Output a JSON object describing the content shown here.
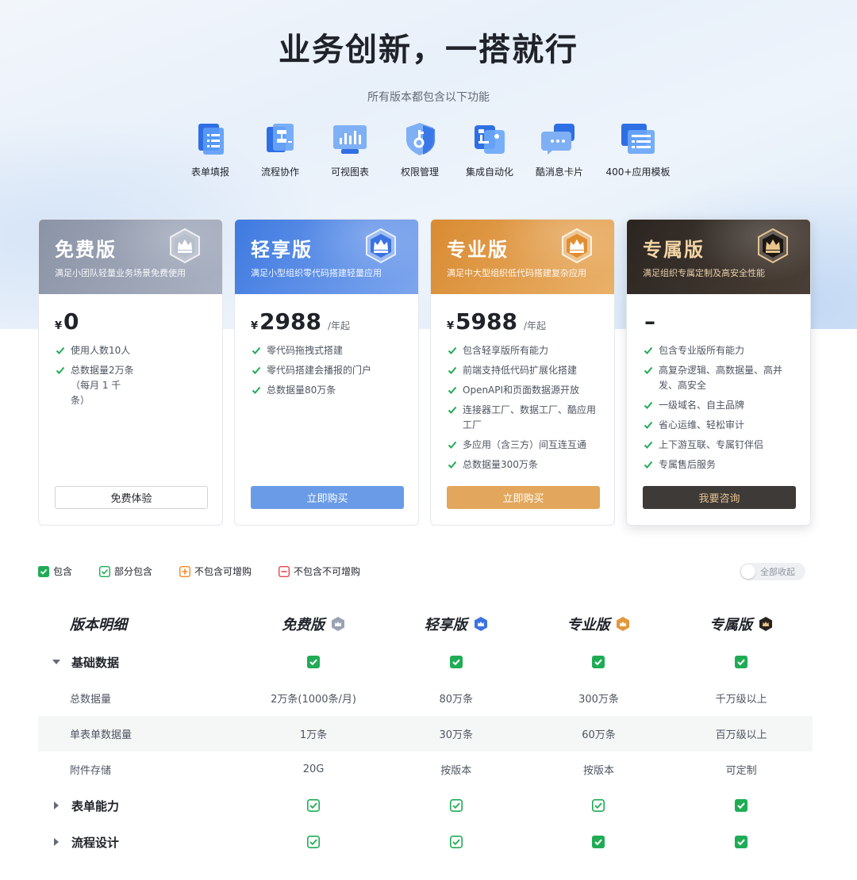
{
  "hero": {
    "title": "业务创新，一搭就行",
    "subtitle": "所有版本都包含以下功能"
  },
  "features": [
    {
      "label": "表单填报",
      "icon": "form-icon"
    },
    {
      "label": "流程协作",
      "icon": "workflow-icon"
    },
    {
      "label": "可视图表",
      "icon": "chart-icon"
    },
    {
      "label": "权限管理",
      "icon": "permission-shield-icon"
    },
    {
      "label": "集成自动化",
      "icon": "integration-icon"
    },
    {
      "label": "酷消息卡片",
      "icon": "message-card-icon"
    },
    {
      "label": "400+应用模板",
      "icon": "template-icon"
    }
  ],
  "plans": [
    {
      "name": "免费版",
      "desc": "满足小团队轻量业务场景免费使用",
      "currency": "¥",
      "price": "0",
      "unit": "",
      "features": [
        "使用人数10人",
        "总数据量2万条（每月 1 千条）"
      ],
      "button": "免费体验",
      "color": "#9aa2b3"
    },
    {
      "name": "轻享版",
      "desc": "满足小型组织零代码搭建轻量应用",
      "currency": "¥",
      "price": "2988",
      "unit": "/年起",
      "features": [
        "零代码拖拽式搭建",
        "零代码搭建会播报的门户",
        "总数据量80万条"
      ],
      "button": "立即购买",
      "color": "#4a82e3"
    },
    {
      "name": "专业版",
      "desc": "满足中大型组织低代码搭建复杂应用",
      "currency": "¥",
      "price": "5988",
      "unit": "/年起",
      "features": [
        "包含轻享版所有能力",
        "前端支持低代码扩展化搭建",
        "OpenAPI和页面数据源开放",
        "连接器工厂、数据工厂、酷应用工厂",
        "多应用（含三方）间互连互通",
        "总数据量300万条"
      ],
      "button": "立即购买",
      "color": "#df9a47"
    },
    {
      "name": "专属版",
      "desc": "满足组织专属定制及高安全性能",
      "currency": "",
      "price": "–",
      "unit": "",
      "features": [
        "包含专业版所有能力",
        "高复杂逻辑、高数据量、高并发、高安全",
        "一级域名、自主品牌",
        "省心运维、轻松审计",
        "上下游互联、专属钉伴侣",
        "专属售后服务"
      ],
      "button": "我要咨询",
      "color": "#3a332d"
    }
  ],
  "legend": {
    "included": "包含",
    "partial": "部分包含",
    "addon": "不包含可增购",
    "unavailable": "不包含不可增购",
    "collapse_all": "全部收起"
  },
  "colors": {
    "green": "#1fac55",
    "orange": "#f08a24",
    "red": "#e5474b"
  },
  "table": {
    "header": "版本明细",
    "columns": [
      "免费版",
      "轻享版",
      "专业版",
      "专属版"
    ],
    "sections": [
      {
        "name": "基础数据",
        "expanded": true,
        "marks": [
          "included",
          "included",
          "included",
          "included"
        ],
        "rows": [
          {
            "name": "总数据量",
            "values": [
              "2万条(1000条/月)",
              "80万条",
              "300万条",
              "千万级以上"
            ]
          },
          {
            "name": "单表单数据量",
            "values": [
              "1万条",
              "30万条",
              "60万条",
              "百万级以上"
            ]
          },
          {
            "name": "附件存储",
            "values": [
              "20G",
              "按版本",
              "按版本",
              "可定制"
            ]
          }
        ]
      },
      {
        "name": "表单能力",
        "expanded": false,
        "marks": [
          "partial",
          "partial",
          "partial",
          "included"
        ]
      },
      {
        "name": "流程设计",
        "expanded": false,
        "marks": [
          "partial",
          "partial",
          "included",
          "included"
        ]
      }
    ]
  }
}
